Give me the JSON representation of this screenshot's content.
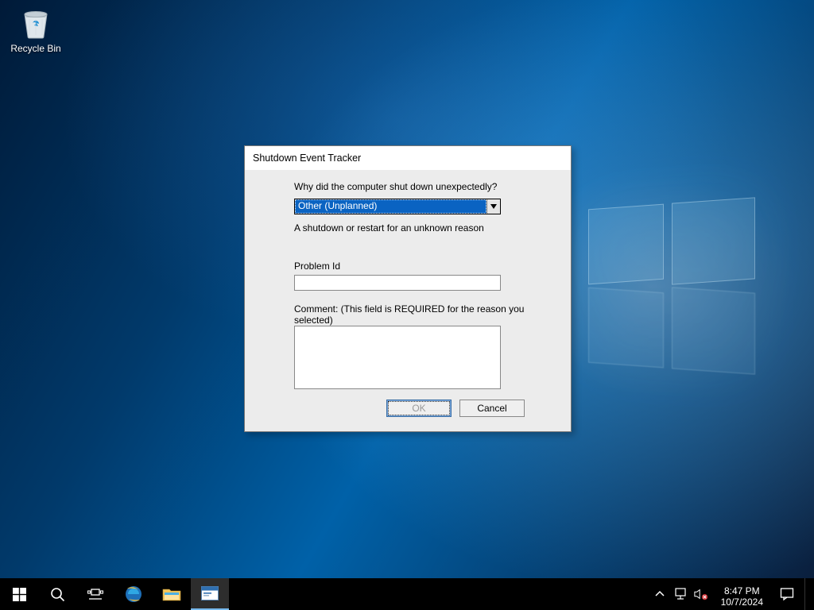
{
  "desktop": {
    "recycle_bin_label": "Recycle Bin"
  },
  "dialog": {
    "title": "Shutdown Event Tracker",
    "question": "Why did the computer shut down unexpectedly?",
    "reason_selected": "Other (Unplanned)",
    "reason_description": "A shutdown or restart for an unknown reason",
    "problem_id_label": "Problem Id",
    "problem_id_value": "",
    "comment_label": "Comment: (This field is REQUIRED for the reason you selected)",
    "comment_value": "",
    "ok_label": "OK",
    "cancel_label": "Cancel"
  },
  "taskbar": {
    "time": "8:47 PM",
    "date": "10/7/2024"
  }
}
